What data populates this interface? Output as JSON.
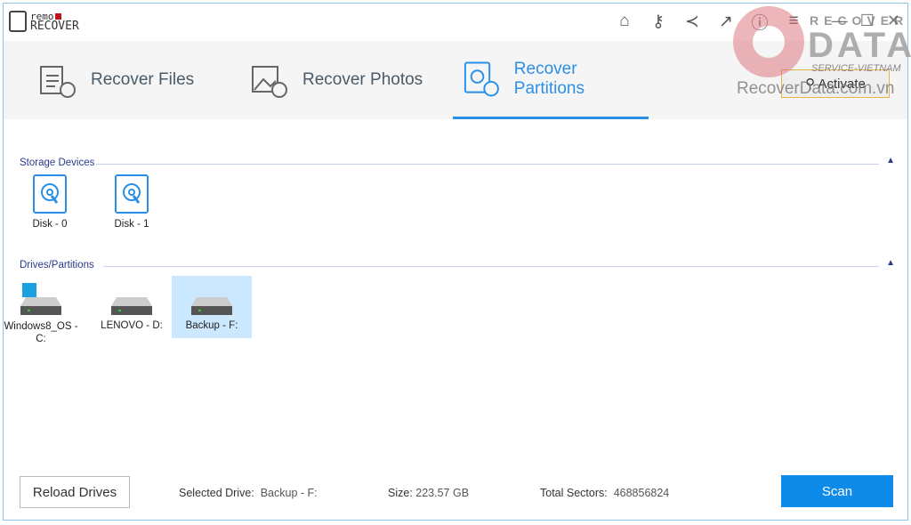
{
  "app": {
    "logo_top": "remo",
    "logo_bottom": "RECOVER"
  },
  "toolbar": {
    "icons": [
      "home-icon",
      "key-icon",
      "share-icon",
      "external-link-icon",
      "help-icon",
      "menu-icon"
    ]
  },
  "window_controls": {
    "minimize": "—",
    "maximize": "☐",
    "close": "✕"
  },
  "tabs": [
    {
      "label": "Recover Files",
      "active": false
    },
    {
      "label": "Recover Photos",
      "active": false
    },
    {
      "label": "Recover Partitions",
      "active": true
    }
  ],
  "activate_label": "Activate",
  "storage": {
    "title": "Storage Devices",
    "items": [
      "Disk - 0",
      "Disk - 1"
    ]
  },
  "drives": {
    "title": "Drives/Partitions",
    "items": [
      "Windows8_OS - C:",
      "LENOVO - D:",
      "Backup - F:"
    ],
    "selected": 2
  },
  "bottom": {
    "reload_label": "Reload Drives",
    "selected_label": "Selected Drive:",
    "selected_value": "Backup - F:",
    "size_label": "Size:",
    "size_value": "223.57 GB",
    "sectors_label": "Total Sectors:",
    "sectors_value": "468856824",
    "scan_label": "Scan"
  },
  "watermark": {
    "line1": "RECOVER",
    "line2": "DATA",
    "line3": "SERVICE-VIETNAM",
    "line4": "RecoverData.com.vn"
  },
  "colors": {
    "accent": "#2b8fe6",
    "scan": "#0e8ae8",
    "selected": "#cce8ff"
  }
}
